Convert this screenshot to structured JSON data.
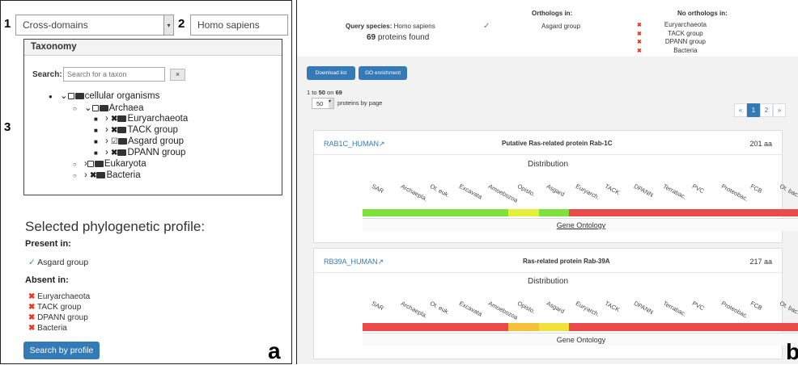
{
  "panel_a": {
    "label_1": "1",
    "label_2": "2",
    "label_3": "3",
    "panel_letter": "a",
    "domain_select": "Cross-domains",
    "species_input": "Homo sapiens",
    "taxonomy_title": "Taxonomy",
    "search_label": "Search:",
    "search_placeholder": "Search for a taxon",
    "clear_label": "×",
    "tree": [
      "cellular organisms",
      "Archaea",
      "Euryarchaeota",
      "TACK group",
      "Asgard group",
      "DPANN group",
      "Eukaryota",
      "Bacteria"
    ],
    "profile_title": "Selected phylogenetic profile:",
    "present_label": "Present in:",
    "present": [
      "Asgard group"
    ],
    "absent_label": "Absent in:",
    "absent": [
      "Euryarchaeota",
      "TACK group",
      "DPANN group",
      "Bacteria"
    ],
    "search_button": "Search by profile"
  },
  "panel_b": {
    "panel_letter": "b",
    "query_label": "Query species:",
    "query_species": "Homo sapiens",
    "proteins_count": "69",
    "proteins_text": "proteins found",
    "orthologs_in_label": "Orthologs in:",
    "orthologs_in": [
      "Asgard group"
    ],
    "no_orthologs_label": "No orthologs in:",
    "no_orthologs": [
      "Euryarchaeota",
      "TACK group",
      "DPANN group",
      "Bacteria"
    ],
    "download_button": "Download list",
    "go_button": "GO enrichment",
    "range_prefix": "1 to ",
    "range_end": "50",
    "range_mid": " on ",
    "range_total": "69",
    "per_page_value": "50",
    "per_page_label": "proteins by page",
    "pagination": [
      "«",
      "1",
      "2",
      "»"
    ],
    "ticks": [
      "SAR",
      "Archaepla.",
      "Ot. euk.",
      "Excavata",
      "Amoebozoa",
      "Opisto.",
      "Asgard",
      "Euryarch.",
      "TACK",
      "DPANN",
      "Terrabac.",
      "PVC",
      "Proteobac.",
      "FCB",
      "Ot. bac."
    ],
    "proteins": [
      {
        "id": "RAB1C_HUMAN",
        "name": "Putative Ras-related protein Rab-1C",
        "length": "201 aa",
        "distribution_title": "Distribution",
        "go_label": "Gene Ontology",
        "segments": [
          {
            "frac": 0.333,
            "color": "#7ee23a"
          },
          {
            "frac": 0.07,
            "color": "#e4ef3a"
          },
          {
            "frac": 0.07,
            "color": "#7ee23a"
          },
          {
            "frac": 0.527,
            "color": "#ea4a4a"
          }
        ]
      },
      {
        "id": "RB39A_HUMAN",
        "name": "Ras-related protein Rab-39A",
        "length": "217 aa",
        "distribution_title": "Distribution",
        "go_label": "Gene Ontology",
        "segments": [
          {
            "frac": 0.333,
            "color": "#ea4a4a"
          },
          {
            "frac": 0.07,
            "color": "#f3c23a"
          },
          {
            "frac": 0.07,
            "color": "#f0e23a"
          },
          {
            "frac": 0.527,
            "color": "#ea4a4a"
          }
        ]
      }
    ]
  }
}
